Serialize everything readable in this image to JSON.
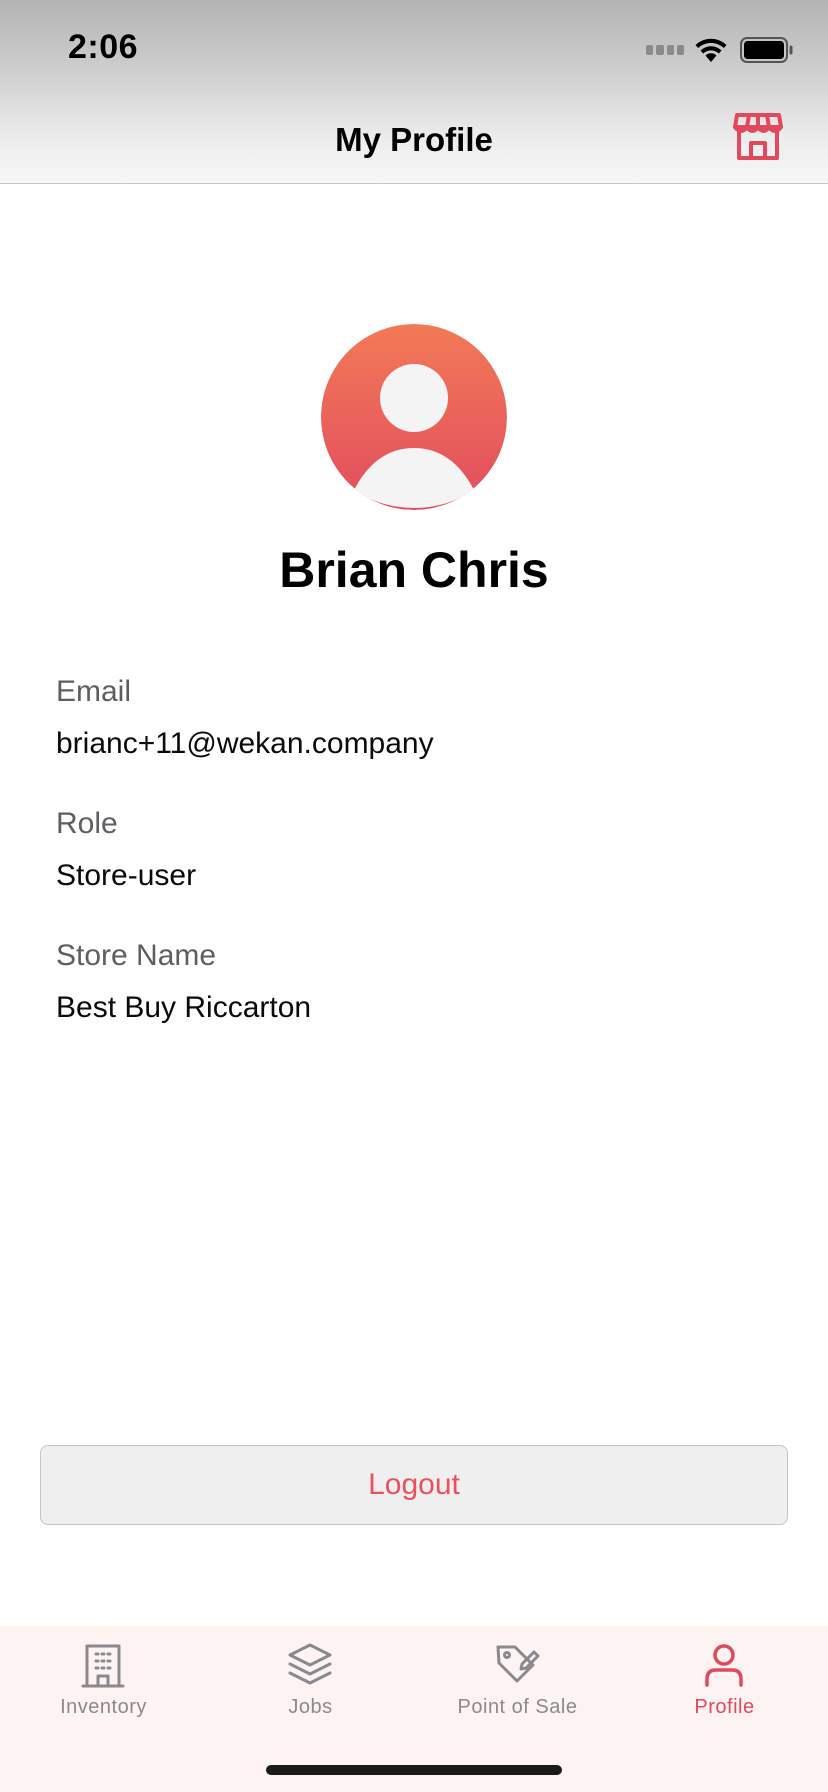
{
  "status_bar": {
    "time": "2:06"
  },
  "header": {
    "title": "My Profile",
    "right_icon": "store-icon"
  },
  "profile": {
    "name": "Brian Chris",
    "avatar_icon": "user-avatar-icon",
    "fields": [
      {
        "label": "Email",
        "value": "brianc+11@wekan.company"
      },
      {
        "label": "Role",
        "value": "Store-user"
      },
      {
        "label": "Store Name",
        "value": "Best Buy Riccarton"
      }
    ]
  },
  "actions": {
    "logout_label": "Logout"
  },
  "tab_bar": {
    "tabs": [
      {
        "label": "Inventory",
        "icon": "building-icon",
        "active": false
      },
      {
        "label": "Jobs",
        "icon": "layers-icon",
        "active": false
      },
      {
        "label": "Point of Sale",
        "icon": "tag-edit-icon",
        "active": false
      },
      {
        "label": "Profile",
        "icon": "user-icon",
        "active": true
      }
    ]
  },
  "colors": {
    "accent": "#E04A5C",
    "avatar_gradient_top": "#F27A56",
    "avatar_gradient_bottom": "#E24C5F",
    "tab_bar_background": "#FDF3F3",
    "inactive_tab": "#8A8A8E"
  }
}
